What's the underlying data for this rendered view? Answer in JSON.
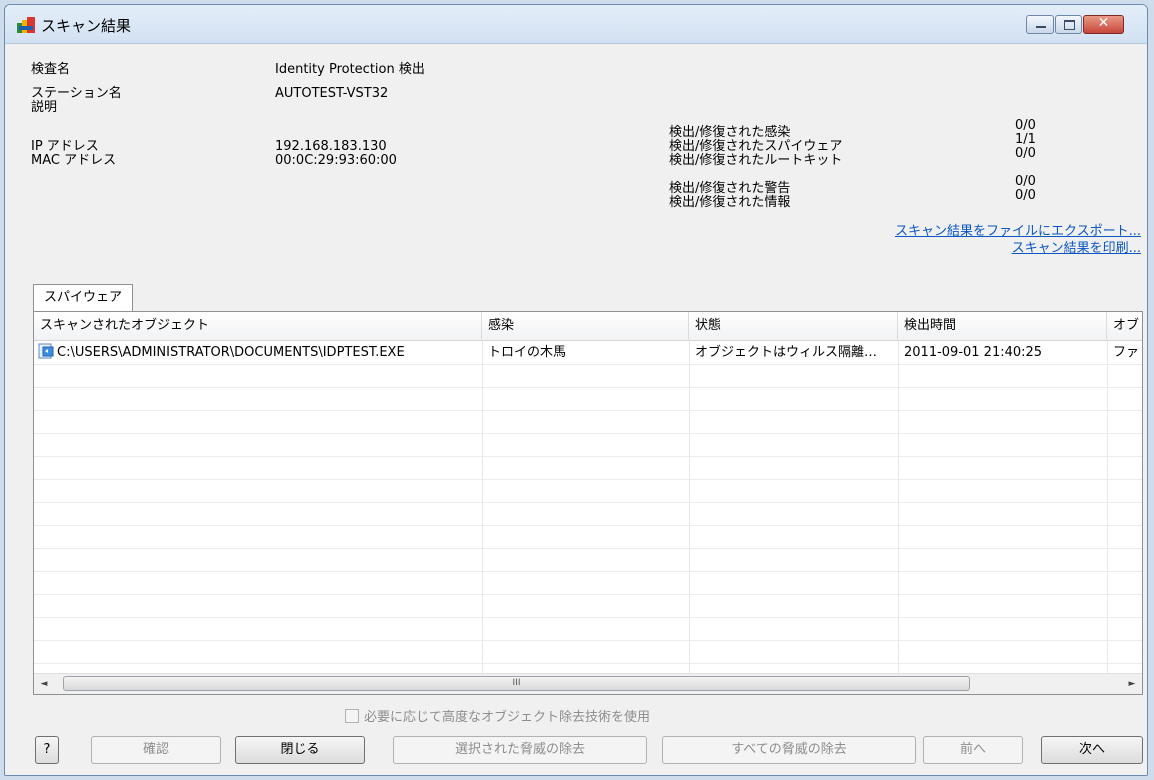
{
  "window": {
    "title": "スキャン結果",
    "icon": "avg-logo-icon"
  },
  "info": {
    "scan_name": {
      "label": "検査名",
      "value": "Identity Protection 検出"
    },
    "station": {
      "label": "ステーション名",
      "value": "AUTOTEST-VST32"
    },
    "description": {
      "label": "説明",
      "value": ""
    },
    "ip": {
      "label": "IP アドレス",
      "value": "192.168.183.130"
    },
    "mac": {
      "label": "MAC アドレス",
      "value": "00:0C:29:93:60:00"
    }
  },
  "stats": [
    {
      "label": "検出/修復された感染",
      "value": "0/0"
    },
    {
      "label": "検出/修復されたスパイウェア",
      "value": "1/1"
    },
    {
      "label": "検出/修復されたルートキット",
      "value": "0/0"
    },
    {
      "label": "検出/修復された警告",
      "value": "0/0"
    },
    {
      "label": "検出/修復された情報",
      "value": "0/0"
    }
  ],
  "links": {
    "export": "スキャン結果をファイルにエクスポート...",
    "print": "スキャン結果を印刷..."
  },
  "tab": {
    "label": "スパイウェア"
  },
  "table": {
    "columns": [
      "スキャンされたオブジェクト",
      "感染",
      "状態",
      "検出時間",
      "オブ"
    ],
    "rows": [
      {
        "object": "C:\\USERS\\ADMINISTRATOR\\DOCUMENTS\\IDPTEST.EXE",
        "infection": "トロイの木馬",
        "status": "オブジェクトはウィルス隔離…",
        "time": "2011-09-01 21:40:25",
        "extra": "ファ"
      }
    ]
  },
  "scrollbar": {
    "left_arrow": "◄",
    "grip": "III",
    "right_arrow": "►"
  },
  "checkbox": {
    "label": "必要に応じて高度なオブジェクト除去技術を使用",
    "checked": false
  },
  "buttons": {
    "help": "?",
    "confirm": "確認",
    "close": "閉じる",
    "remove_selected": "選択された脅威の除去",
    "remove_all": "すべての脅威の除去",
    "prev": "前へ",
    "next": "次へ"
  }
}
